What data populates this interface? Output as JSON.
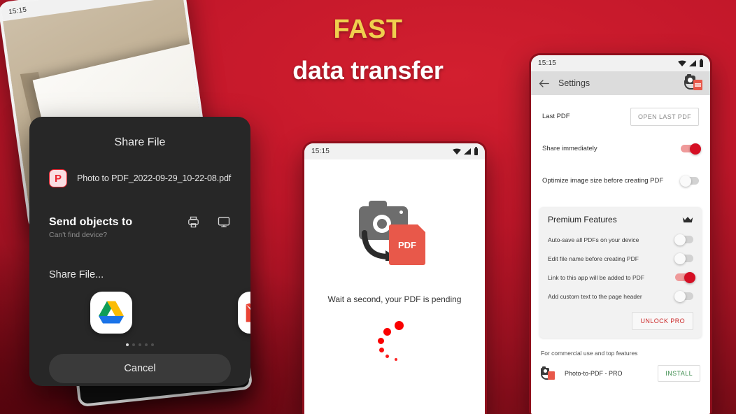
{
  "headline": {
    "line1": "FAST",
    "line2": "data transfer",
    "accent_color": "#f0cf4e",
    "text_color": "#ffffff"
  },
  "background": {
    "color_top": "#d21f2f",
    "color_bottom": "#6e0a14"
  },
  "tablet_left": {
    "status_time": "15:15"
  },
  "share_dialog": {
    "title": "Share File",
    "file_icon": "pdf-file-icon",
    "file_icon_letter": "P",
    "file_name": "Photo to PDF_2022-09-29_10-22-08.pdf",
    "send_title": "Send objects to",
    "send_hint": "Can't find device?",
    "device_icons": [
      "printer-icon",
      "monitor-icon"
    ],
    "share_label": "Share File...",
    "apps": [
      {
        "name": "google-drive",
        "label": "Google Drive"
      },
      {
        "name": "gmail",
        "label": "Gmail"
      }
    ],
    "page_dots": 5,
    "page_dot_active": 0,
    "cancel_label": "Cancel"
  },
  "phone_center": {
    "status_time": "15:15",
    "hero_icon": "camera-to-pdf-icon",
    "pdf_label": "PDF",
    "wait_text": "Wait a second, your PDF is pending",
    "spinner_color": "#fa0000"
  },
  "phone_right": {
    "status_time": "15:15",
    "appbar": {
      "back_icon": "arrow-back-icon",
      "title": "Settings",
      "logo_icon": "photo-to-pdf-logo-icon"
    },
    "settings": [
      {
        "label": "Last PDF",
        "control": "button",
        "button_label": "OPEN LAST PDF"
      },
      {
        "label": "Share immediately",
        "control": "toggle",
        "value": "on"
      },
      {
        "label": "Optimize image size before creating PDF",
        "control": "toggle",
        "value": "off"
      }
    ],
    "premium": {
      "title": "Premium Features",
      "badge_icon": "crown-icon",
      "rows": [
        {
          "label": "Auto-save all PDFs on your device",
          "value": "off"
        },
        {
          "label": "Edit file name before creating PDF",
          "value": "off"
        },
        {
          "label": "Link to this app will be added to PDF",
          "value": "on"
        },
        {
          "label": "Add custom text to the page header",
          "value": "off"
        }
      ],
      "unlock_label": "UNLOCK PRO",
      "unlock_color": "#cc2b2b"
    },
    "promo": {
      "text": "For commercial use and top features",
      "logo_icon": "photo-to-pdf-logo-icon",
      "app_name": "Photo-to-PDF - PRO",
      "install_label": "INSTALL",
      "install_color": "#3e8e4f"
    }
  }
}
